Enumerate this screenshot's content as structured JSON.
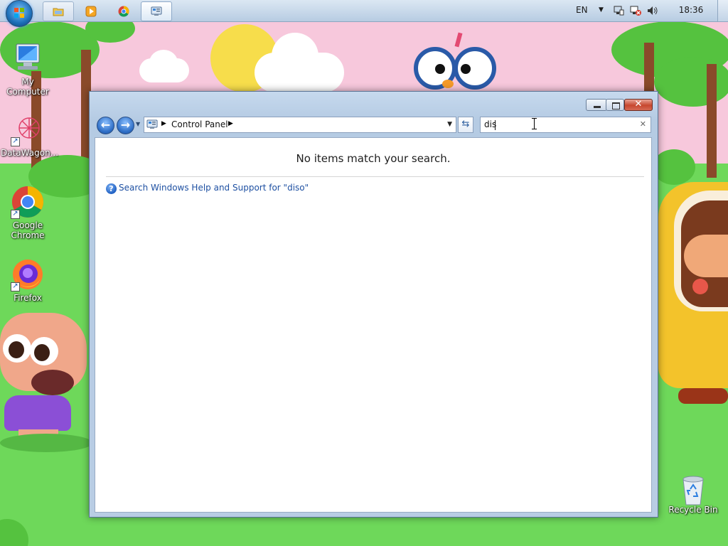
{
  "taskbar": {
    "start_icon": "windows-start-orb",
    "buttons": [
      {
        "name": "file-explorer",
        "icon": "folder-icon"
      },
      {
        "name": "media-player",
        "icon": "media-player-icon"
      },
      {
        "name": "chrome",
        "icon": "chrome-icon"
      },
      {
        "name": "control-panel",
        "icon": "control-panel-icon",
        "active": true
      }
    ],
    "language": "EN",
    "clock": "18:36"
  },
  "desktop": {
    "icons": [
      {
        "label": "My Computer",
        "icon": "computer-icon"
      },
      {
        "label": "DataWagon...",
        "icon": "datawagon-icon"
      },
      {
        "label": "Google Chrome",
        "icon": "chrome-icon"
      },
      {
        "label": "Firefox",
        "icon": "firefox-icon"
      },
      {
        "label": "Recycle Bin",
        "icon": "recycle-bin-icon"
      }
    ]
  },
  "window": {
    "breadcrumb": [
      "Control Panel"
    ],
    "search": {
      "value": "dis"
    },
    "message": "No items match your search.",
    "help_link": "Search Windows Help and Support for \"diso\""
  },
  "colors": {
    "link": "#1e50a2",
    "wallpaper_sky": "#f7c8dc",
    "wallpaper_grass": "#6ed85a"
  }
}
